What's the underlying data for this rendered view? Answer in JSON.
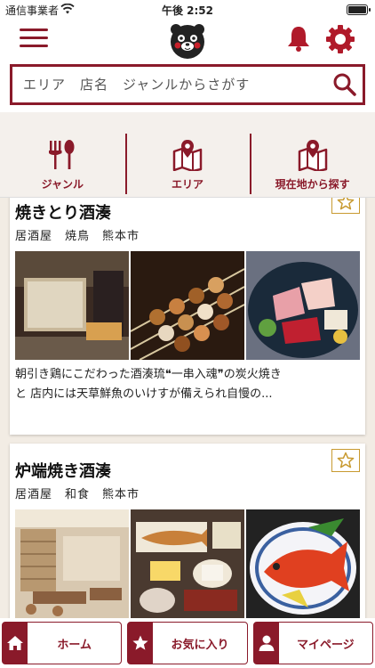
{
  "status_bar": {
    "carrier": "通信事業者",
    "time": "午後 2:52"
  },
  "header": {
    "menu_icon": "hamburger-menu-icon",
    "mascot": "kumamon-mascot",
    "bell_icon": "bell-icon",
    "gear_icon": "gear-icon"
  },
  "search": {
    "placeholder": "エリア　店名　ジャンルからさがす"
  },
  "categories": [
    {
      "label": "ジャンル",
      "icon": "fork-spoon-icon"
    },
    {
      "label": "エリア",
      "icon": "map-pin-icon"
    },
    {
      "label": "現在地から探す",
      "icon": "map-pin-icon"
    }
  ],
  "shops": [
    {
      "name": "焼きとり酒湊",
      "tags": "居酒屋　焼鳥　熊本市",
      "description_line1": "朝引き鶏にこだわった酒湊琉❝一串入魂❞の炭火焼き",
      "description_line2": "と 店内には天草鮮魚のいけすが備えられ自慢の..."
    },
    {
      "name": "炉端焼き酒湊",
      "tags": "居酒屋　和食　熊本市"
    }
  ],
  "bottom_nav": [
    {
      "label": "ホーム",
      "icon": "home-icon"
    },
    {
      "label": "お気に入り",
      "icon": "star-icon"
    },
    {
      "label": "マイページ",
      "icon": "person-icon"
    }
  ],
  "colors": {
    "brand": "#8a1a2a",
    "favorite": "#c89a30",
    "background": "#f2ece4"
  }
}
